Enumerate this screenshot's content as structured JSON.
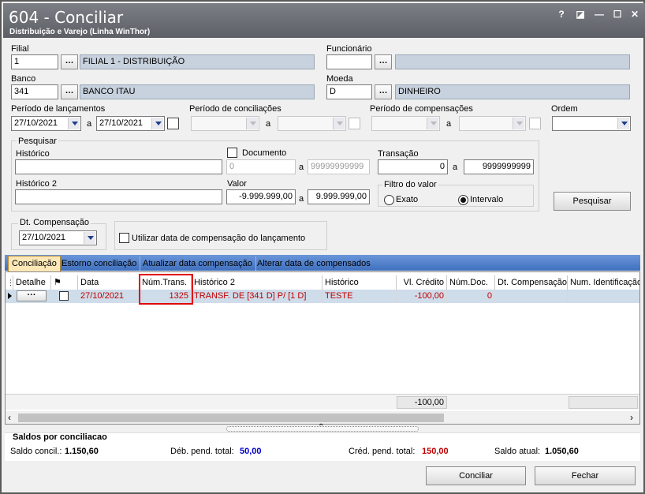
{
  "window": {
    "title": "604 - Conciliar",
    "subtitle": "Distribuição e Varejo (Linha WinThor)",
    "controls": [
      "?",
      "◪",
      "—",
      "☐",
      "✕"
    ]
  },
  "filial": {
    "label": "Filial",
    "code": "1",
    "name": "FILIAL 1 - DISTRIBUIÇÃO"
  },
  "funcionario": {
    "label": "Funcionário",
    "code": "",
    "name": ""
  },
  "banco": {
    "label": "Banco",
    "code": "341",
    "name": "BANCO ITAU"
  },
  "moeda": {
    "label": "Moeda",
    "code": "D",
    "name": "DINHEIRO"
  },
  "periodo_lancamentos": {
    "label": "Período de lançamentos",
    "from": "27/10/2021",
    "sep": "a",
    "to": "27/10/2021"
  },
  "periodo_conciliacoes": {
    "label": "Período de conciliações",
    "sep": "a"
  },
  "periodo_compensacoes": {
    "label": "Período de compensações",
    "sep": "a"
  },
  "ordem": {
    "label": "Ordem",
    "value": ""
  },
  "pesquisar": {
    "group_label": "Pesquisar",
    "historico_label": "Histórico",
    "historico2_label": "Histórico 2",
    "documento_label": "Documento",
    "documento_from": "0",
    "documento_sep": "a",
    "documento_to": "99999999999",
    "transacao_label": "Transação",
    "transacao_from": "0",
    "transacao_sep": "a",
    "transacao_to": "9999999999",
    "valor_label": "Valor",
    "valor_from": "-9.999.999,00",
    "valor_sep": "a",
    "valor_to": "9.999.999,00",
    "filtro_label": "Filtro do valor",
    "exato_label": "Exato",
    "intervalo_label": "Intervalo",
    "button": "Pesquisar"
  },
  "dt_compensacao": {
    "label": "Dt. Compensação",
    "value": "27/10/2021"
  },
  "utilizar_data_label": "Utilizar data de compensação do lançamento",
  "tabs": [
    "Conciliação",
    "Estorno conciliação",
    "Atualizar data compensação",
    "Alterar data de compensados"
  ],
  "grid": {
    "columns": [
      "Detalhe",
      "",
      "Data",
      "Núm.Trans.",
      "Histórico 2",
      "Histórico",
      "Vl. Crédito",
      "Núm.Doc.",
      "Dt. Compensação",
      "Num. Identificação"
    ],
    "rows": [
      {
        "detalhe": "···",
        "data": "27/10/2021",
        "num_trans": "1325",
        "historico2": "TRANSF. DE [341 D] P/ [1 D]",
        "historico": "TESTE",
        "vl_credito": "-100,00",
        "num_doc": "0",
        "dt_compensacao": "",
        "num_ident": ""
      }
    ],
    "total_credito": "-100,00"
  },
  "saldos": {
    "title": "Saldos por conciliacao",
    "saldo_concil_label": "Saldo concil.:",
    "saldo_concil": "1.150,60",
    "deb_label": "Déb. pend. total:",
    "deb_value": "50,00",
    "cred_label": "Créd. pend. total:",
    "cred_value": "150,00",
    "saldo_atual_label": "Saldo atual:",
    "saldo_atual": "1.050,60"
  },
  "buttons": {
    "conciliar": "Conciliar",
    "fechar": "Fechar"
  },
  "colors": {
    "title_bar": "#6b6d74",
    "readonly_field": "#c8d2de",
    "tab_bar": "#4f7fcb",
    "active_tab": "#fce7b7",
    "row_text": "#c00000",
    "highlight_box": "#e00000",
    "deb_value": "#0000cc",
    "cred_value": "#c00000"
  }
}
